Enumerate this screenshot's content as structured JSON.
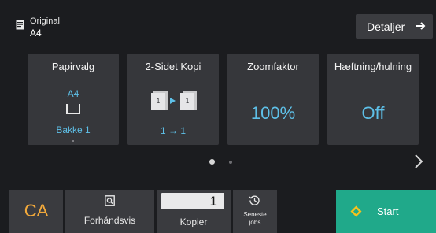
{
  "original": {
    "label": "Original",
    "size": "A4",
    "icon": "document-icon"
  },
  "details_button": {
    "label": "Detaljer",
    "icon": "arrow-right-icon"
  },
  "tiles": [
    {
      "title": "Papirvalg",
      "paper_size": "A4",
      "tray_icon": "paper-tray-icon",
      "tray": "Bakke 1"
    },
    {
      "title": "2-Sidet Kopi",
      "icon": "duplex-copy-icon",
      "value": "1 → 1"
    },
    {
      "title": "Zoomfaktor",
      "value": "100%"
    },
    {
      "title": "Hæftning/hulning",
      "value": "Off"
    }
  ],
  "pager": {
    "pages": 2,
    "current": 1,
    "next_icon": "chevron-right-icon"
  },
  "bottom": {
    "ca": {
      "label": "CA"
    },
    "preview": {
      "label": "Forhåndsvis",
      "icon": "preview-icon"
    },
    "copies": {
      "value": "1",
      "label": "Kopier"
    },
    "recent": {
      "label_line1": "Seneste",
      "label_line2": "jobs",
      "icon": "history-icon"
    },
    "start": {
      "label": "Start",
      "icon": "start-diamond-icon"
    }
  },
  "colors": {
    "accent": "#5ec0e8",
    "ca": "#f2a93b",
    "start": "#20a98a",
    "tile": "#36373b",
    "background": "#1b1c1f"
  }
}
